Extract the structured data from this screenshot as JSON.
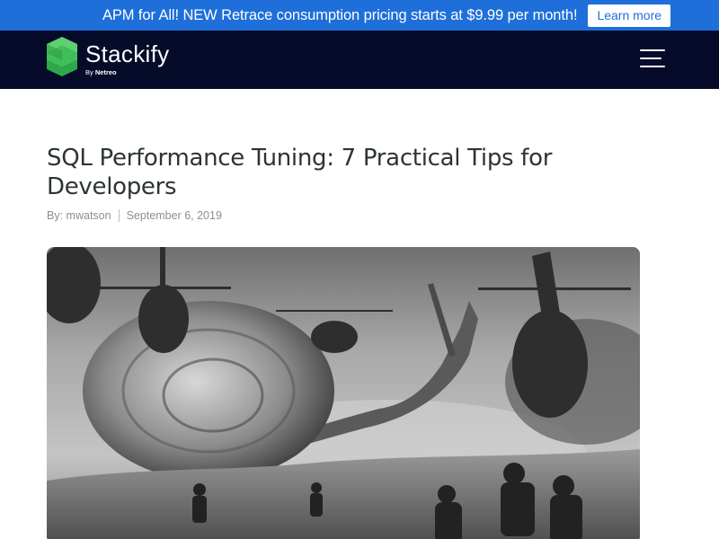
{
  "promo": {
    "text": "APM for All! NEW Retrace consumption pricing starts at $9.99 per month!",
    "button_label": "Learn more"
  },
  "header": {
    "logo_word": "Stackify",
    "logo_by": "By",
    "logo_company": "Netreo",
    "menu_icon": "hamburger-menu-icon",
    "colors": {
      "banner": "#1e6fd9",
      "navbar": "#060b2a",
      "logo_green": "#3fbf5a"
    }
  },
  "article": {
    "title": "SQL Performance Tuning: 7 Practical Tips for Developers",
    "author_prefix": "By:",
    "author": "mwatson",
    "date": "September 6, 2019"
  }
}
